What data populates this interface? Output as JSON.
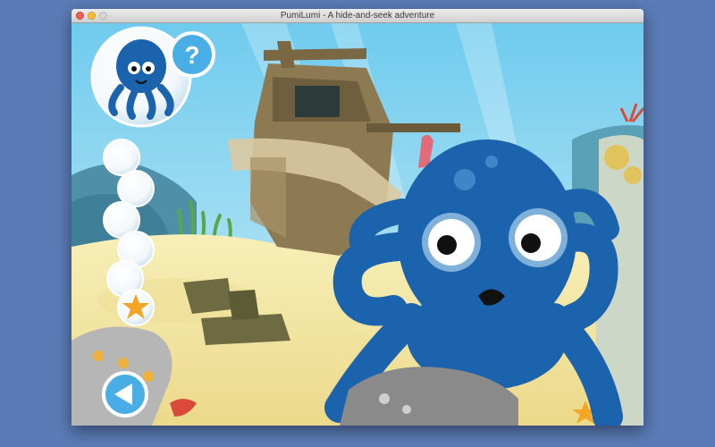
{
  "window": {
    "title": "PumiLumi - A hide-and-seek adventure"
  },
  "hud": {
    "character_icon": "octopus-icon",
    "help_icon": "question-mark-icon",
    "help_symbol": "?",
    "slots_total": 6,
    "slots_collected": 1,
    "slot_icon_collected": "starfish-icon",
    "back_icon": "back-arrow-icon"
  },
  "colors": {
    "desktop": "#5a7bb6",
    "octopus": "#1c63ad",
    "sea": "#8fd3f0",
    "sand": "#f4e9a6",
    "ui_button": "#4aaee6"
  }
}
